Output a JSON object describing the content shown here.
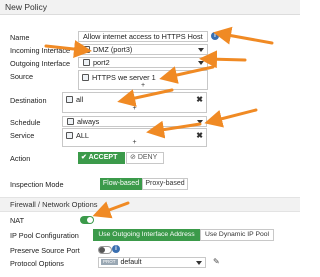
{
  "window": {
    "title": "New Policy"
  },
  "form": {
    "name": {
      "label": "Name",
      "value": "Allow internet access to HTTPS Host"
    },
    "incoming": {
      "label": "Incoming Interface",
      "value": "DMZ (port3)"
    },
    "outgoing": {
      "label": "Outgoing Interface",
      "value": "port2"
    },
    "source": {
      "label": "Source",
      "value": "HTTPS we server 1"
    },
    "destination": {
      "label": "Destination",
      "value": "all"
    },
    "schedule": {
      "label": "Schedule",
      "value": "always"
    },
    "service": {
      "label": "Service",
      "value": "ALL"
    },
    "action": {
      "label": "Action",
      "accept": "ACCEPT",
      "deny": "DENY"
    },
    "inspection": {
      "label": "Inspection Mode",
      "flow": "Flow-based",
      "proxy": "Proxy-based"
    }
  },
  "firewall_section": {
    "title": "Firewall / Network Options",
    "nat_label": "NAT",
    "ip_pool_label": "IP Pool Configuration",
    "use_outgoing": "Use Outgoing Interface Address",
    "use_dynamic": "Use Dynamic IP Pool",
    "preserve_label": "Preserve Source Port",
    "protocol_label": "Protocol Options",
    "protocol_tag": "PROT",
    "protocol_value": "default"
  },
  "symbols": {
    "plus": "+",
    "remove": "✖",
    "check": "✔",
    "deny_icon": "⊘",
    "info": "i",
    "edit": "✎"
  },
  "colors": {
    "accent_green": "#3b9a4a",
    "annotation_orange": "#f08a24",
    "info_blue": "#3a6fb0"
  }
}
